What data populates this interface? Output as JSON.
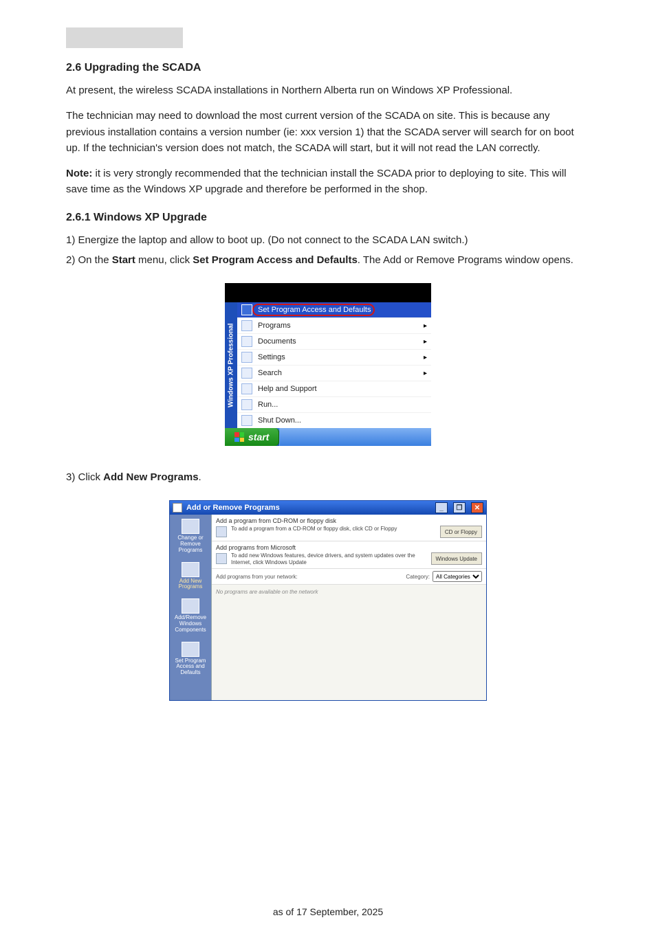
{
  "header": {
    "placeholder": ""
  },
  "intro": {
    "title": "2.6  Upgrading the SCADA",
    "p1": "At present, the wireless SCADA installations in Northern Alberta run on Windows XP Professional.",
    "p2": "The technician may need to download the most current version of the SCADA on site.  This is because any previous installation contains a version number (ie: xxx version 1) that the SCADA server will search for on boot up.  If the technician's version does not match, the SCADA will start, but it will not read the LAN correctly.",
    "note_label": "Note:",
    "note_text": "  it is very strongly recommended that the technician install the SCADA prior to deploying to site.  This will save time as the Windows XP upgrade and therefore be performed in the shop."
  },
  "subsection": {
    "title": "2.6.1  Windows XP Upgrade",
    "s1": "1)  Energize the laptop and allow to boot up.  (Do not connect to the SCADA LAN switch.)",
    "s2_a": "2)  On the ",
    "s2_b": " menu, click ",
    "s2_c": "Set Program Access and Defaults",
    "s2_d": ".  The Add or Remove Programs window opens.",
    "start_word": "Start"
  },
  "start_menu": {
    "brand": "Windows XP Professional",
    "items": [
      {
        "label": "Set Program Access and Defaults",
        "arrow": false,
        "hi": true,
        "ring": true
      },
      {
        "label": "Programs",
        "arrow": true
      },
      {
        "label": "Documents",
        "arrow": true
      },
      {
        "label": "Settings",
        "arrow": true
      },
      {
        "label": "Search",
        "arrow": true
      },
      {
        "label": "Help and Support",
        "arrow": false
      },
      {
        "label": "Run...",
        "arrow": false
      },
      {
        "label": "Shut Down...",
        "arrow": false
      }
    ],
    "start_button": "start"
  },
  "after_fig1": {
    "s3_a": "3)  Click ",
    "s3_b": "Add New Programs",
    "s3_c": "."
  },
  "arp": {
    "title": "Add or Remove Programs",
    "side": {
      "change": "Change or Remove Programs",
      "addnew": "Add New Programs",
      "winc": "Add/Remove Windows Components",
      "access": "Set Program Access and Defaults"
    },
    "sec1": {
      "hdr": "Add a program from CD-ROM or floppy disk",
      "txt": "To add a program from a CD-ROM or floppy disk, click CD or Floppy",
      "btn": "CD or Floppy"
    },
    "sec2": {
      "hdr": "Add programs from Microsoft",
      "txt": "To add new Windows features, device drivers, and system updates over the Internet, click Windows Update",
      "btn": "Windows Update"
    },
    "cat": {
      "label": "Add programs from your network:",
      "catword": "Category:",
      "sel": "All Categories"
    },
    "empty": "No programs are available on the network"
  },
  "footer": {
    "text": "as of 17 September, 2025"
  }
}
